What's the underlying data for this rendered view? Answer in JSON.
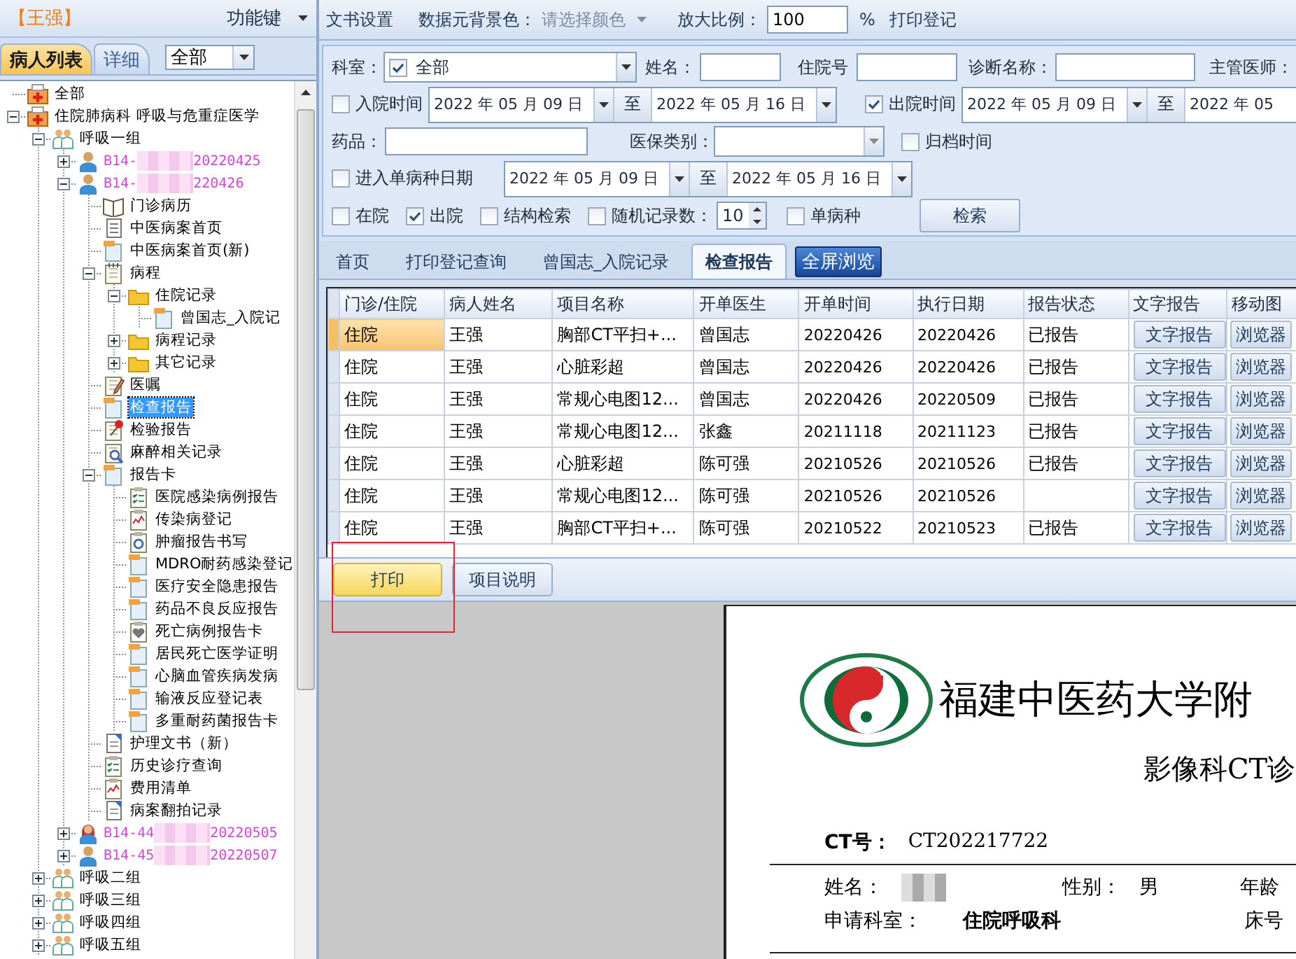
{
  "patient_header": {
    "name": "【王强】",
    "function_key": "功能键"
  },
  "left_tabs": [
    {
      "label": "病人列表",
      "selected": true
    },
    {
      "label": "详细",
      "selected": false
    }
  ],
  "filter_dropdown": {
    "value": "全部"
  },
  "tree": [
    {
      "label": "全部",
      "kind": "department",
      "selected": false
    },
    {
      "label": "住院肺病科 呼吸与危重症医学",
      "kind": "department",
      "selected": false,
      "expanded": true,
      "children": [
        {
          "label": "呼吸一组",
          "kind": "group",
          "selected": false,
          "expanded": true,
          "children": [
            {
              "label": "B14-",
              "date": "20220425",
              "kind": "patient",
              "selected": false,
              "expanded": false
            },
            {
              "label": "B14-",
              "date": "220426",
              "kind": "patient",
              "selected": false,
              "expanded": true,
              "children": [
                {
                  "label": "门诊病历",
                  "kind": "book",
                  "selected": false
                },
                {
                  "label": "中医病案首页",
                  "kind": "document",
                  "selected": false
                },
                {
                  "label": "中医病案首页(新)",
                  "kind": "form",
                  "selected": false
                },
                {
                  "label": "病程",
                  "kind": "notepad",
                  "selected": false,
                  "expanded": true,
                  "children": [
                    {
                      "label": "住院记录",
                      "kind": "folder",
                      "selected": false,
                      "expanded": true,
                      "children": [
                        {
                          "label": "曾国志_入院记",
                          "kind": "form",
                          "selected": false
                        }
                      ]
                    },
                    {
                      "label": "病程记录",
                      "kind": "folder",
                      "selected": false,
                      "expanded": false
                    },
                    {
                      "label": "其它记录",
                      "kind": "folder",
                      "selected": false,
                      "expanded": false
                    }
                  ]
                },
                {
                  "label": "医嘱",
                  "kind": "order",
                  "selected": false
                },
                {
                  "label": "检查报告",
                  "kind": "form",
                  "selected": true
                },
                {
                  "label": "检验报告",
                  "kind": "lab",
                  "selected": false
                },
                {
                  "label": "麻醉相关记录",
                  "kind": "anesthesia",
                  "selected": false
                },
                {
                  "label": "报告卡",
                  "kind": "form",
                  "selected": false,
                  "expanded": true,
                  "children": [
                    {
                      "label": "医院感染病例报告",
                      "kind": "checklist",
                      "selected": false
                    },
                    {
                      "label": "传染病登记",
                      "kind": "chart",
                      "selected": false
                    },
                    {
                      "label": "肿瘤报告书写",
                      "kind": "tumor",
                      "selected": false
                    },
                    {
                      "label": "MDRO耐药感染登记",
                      "kind": "form",
                      "selected": false
                    },
                    {
                      "label": "医疗安全隐患报告",
                      "kind": "form",
                      "selected": false
                    },
                    {
                      "label": "药品不良反应报告",
                      "kind": "form",
                      "selected": false
                    },
                    {
                      "label": "死亡病例报告卡",
                      "kind": "death",
                      "selected": false
                    },
                    {
                      "label": "居民死亡医学证明",
                      "kind": "form",
                      "selected": false
                    },
                    {
                      "label": "心脑血管疾病发病",
                      "kind": "form",
                      "selected": false
                    },
                    {
                      "label": "输液反应登记表",
                      "kind": "form",
                      "selected": false
                    },
                    {
                      "label": "多重耐药菌报告卡",
                      "kind": "form",
                      "selected": false
                    }
                  ]
                },
                {
                  "label": "护理文书（新）",
                  "kind": "nursing",
                  "selected": false
                },
                {
                  "label": "历史诊疗查询",
                  "kind": "checklist",
                  "selected": false
                },
                {
                  "label": "费用清单",
                  "kind": "chart",
                  "selected": false
                },
                {
                  "label": "病案翻拍记录",
                  "kind": "nursing",
                  "selected": false
                }
              ]
            },
            {
              "label": "B14-44",
              "date": "20220505",
              "kind": "patient-f",
              "selected": false,
              "expanded": false
            },
            {
              "label": "B14-45",
              "date": "20220507",
              "kind": "patient",
              "selected": false,
              "expanded": false
            }
          ]
        },
        {
          "label": "呼吸二组",
          "kind": "group",
          "selected": false,
          "expanded": false
        },
        {
          "label": "呼吸三组",
          "kind": "group",
          "selected": false,
          "expanded": false
        },
        {
          "label": "呼吸四组",
          "kind": "group",
          "selected": false,
          "expanded": false
        },
        {
          "label": "呼吸五组",
          "kind": "group",
          "selected": false,
          "expanded": false
        }
      ]
    }
  ],
  "toolbar": {
    "doc_settings": "文书设置",
    "bg_color_label": "数据元背景色：",
    "color_picker": {
      "placeholder": "请选择颜色",
      "disabled": true
    },
    "zoom_label": "放大比例：",
    "zoom_value": "100",
    "zoom_unit": "%",
    "print_register": "打印登记"
  },
  "filters": {
    "department": {
      "label": "科室：",
      "checked": true,
      "value": "全部"
    },
    "name": {
      "label": "姓名："
    },
    "inpatient_no": {
      "label": "住院号"
    },
    "diagnosis": {
      "label": "诊断名称："
    },
    "attending": {
      "label": "主管医师："
    },
    "admission": {
      "label": "入院时间",
      "checked": false,
      "from": "2022 年 05 月 09 日",
      "separator": "至",
      "to": "2022 年 05 月 16 日"
    },
    "discharge": {
      "label": "出院时间",
      "checked": true,
      "from": "2022 年 05 月 09 日",
      "separator": "至",
      "to": "2022 年 05"
    },
    "drug": {
      "label": "药品："
    },
    "insurance": {
      "label": "医保类别："
    },
    "archive": {
      "label": "归档时间",
      "checked": false
    },
    "disease_entry": {
      "label": "进入单病种日期",
      "checked": false,
      "from": "2022 年 05 月 09 日",
      "separator": "至",
      "to": "2022 年 05 月 16 日"
    },
    "status": [
      {
        "label": "在院",
        "checked": false
      },
      {
        "label": "出院",
        "checked": true
      },
      {
        "label": "结构检索",
        "checked": false
      }
    ],
    "random": {
      "label": "随机记录数：",
      "checked": false,
      "value": "10"
    },
    "single_disease": {
      "label": "单病种",
      "checked": false
    },
    "search_button": "检索"
  },
  "report_tabs": [
    {
      "label": "首页",
      "selected": false
    },
    {
      "label": "打印登记查询",
      "selected": false
    },
    {
      "label": "曾国志_入院记录",
      "selected": false
    },
    {
      "label": "检查报告",
      "selected": true
    }
  ],
  "fullscreen_button": "全屏浏览",
  "table": {
    "columns": [
      "门诊/住院",
      "病人姓名",
      "项目名称",
      "开单医生",
      "开单时间",
      "执行日期",
      "报告状态",
      "文字报告",
      "移动图"
    ],
    "rows": [
      {
        "selected": true,
        "type": "住院",
        "patient": "王强",
        "item": "胸部CT平扫+...",
        "doctor": "曾国志",
        "ordered": "20220426",
        "executed": "20220426",
        "status": "已报告",
        "text_report": "文字报告",
        "image": "浏览器"
      },
      {
        "selected": false,
        "type": "住院",
        "patient": "王强",
        "item": "心脏彩超",
        "doctor": "曾国志",
        "ordered": "20220426",
        "executed": "20220426",
        "status": "已报告",
        "text_report": "文字报告",
        "image": "浏览器"
      },
      {
        "selected": false,
        "type": "住院",
        "patient": "王强",
        "item": "常规心电图12...",
        "doctor": "曾国志",
        "ordered": "20220426",
        "executed": "20220509",
        "status": "已报告",
        "text_report": "文字报告",
        "image": "浏览器"
      },
      {
        "selected": false,
        "type": "住院",
        "patient": "王强",
        "item": "常规心电图12...",
        "doctor": "张鑫",
        "ordered": "20211118",
        "executed": "20211123",
        "status": "已报告",
        "text_report": "文字报告",
        "image": "浏览器"
      },
      {
        "selected": false,
        "type": "住院",
        "patient": "王强",
        "item": "心脏彩超",
        "doctor": "陈可强",
        "ordered": "20210526",
        "executed": "20210526",
        "status": "已报告",
        "text_report": "文字报告",
        "image": "浏览器"
      },
      {
        "selected": false,
        "type": "住院",
        "patient": "王强",
        "item": "常规心电图12...",
        "doctor": "陈可强",
        "ordered": "20210526",
        "executed": "20210526",
        "text_report": "文字报告",
        "image": "浏览器"
      },
      {
        "selected": false,
        "type": "住院",
        "patient": "王强",
        "item": "胸部CT平扫+...",
        "doctor": "陈可强",
        "ordered": "20210522",
        "executed": "20210523",
        "status": "已报告",
        "text_report": "文字报告",
        "image": "浏览器"
      }
    ]
  },
  "actions": [
    {
      "label": "打印",
      "kind": "primary"
    },
    {
      "label": "项目说明",
      "kind": "secondary"
    }
  ],
  "report": {
    "hospital_name": "福建中医药大学附",
    "subtitle": "影像科CT诊",
    "ct_label": "CT号：",
    "ct_value": "CT202217722",
    "name_label": "姓名：",
    "sex_label": "性别：",
    "sex_value": "男",
    "age_label": "年龄",
    "dept_label": "申请科室：",
    "dept_value": "住院呼吸科",
    "bed_label": "床号"
  }
}
